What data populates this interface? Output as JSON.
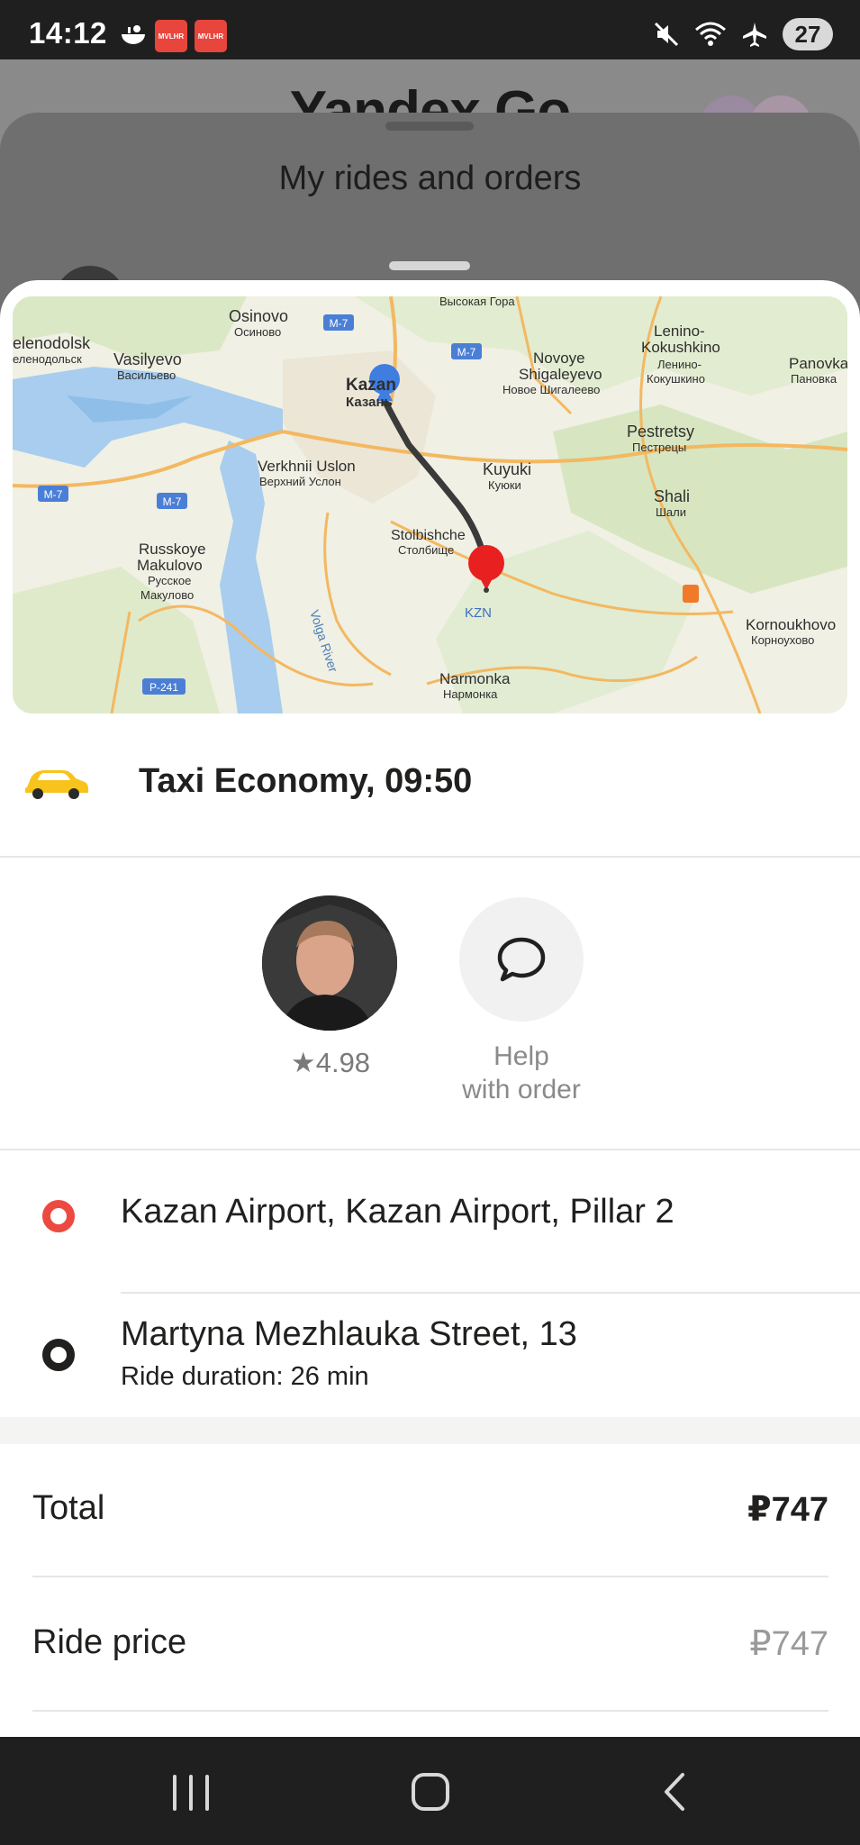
{
  "status_bar": {
    "time": "14:12",
    "battery": "27",
    "badge_label": "MVLHR",
    "icons": [
      "bowl-icon",
      "app-badge-icon",
      "app-badge-icon",
      "mute-icon",
      "wifi-icon",
      "airplane-icon",
      "battery-icon"
    ]
  },
  "background": {
    "app_logo": "Yandex Go",
    "sheet_title": "My rides and orders"
  },
  "map": {
    "labels": {
      "osinovo": "Osinovo",
      "osinovo_ru": "Осиново",
      "vysokaya_gora_ru": "Высокая Гора",
      "zelenodolsk": "elenodolsk",
      "zelenodolsk_ru": "еленодольск",
      "vasilyevo": "Vasilyevo",
      "vasilyevo_ru": "Васильево",
      "kazan": "Kazan",
      "kazan_ru": "Казань",
      "novoye": "Novoye",
      "shigaleyevo": "Shigaleyevo",
      "novoye_ru": "Новое Шигалеево",
      "lenino": "Lenino-",
      "kokushkino": "Kokushkino",
      "lenino_ru": "Ленино-",
      "kokushkino_ru": "Кокушкино",
      "panovka": "Panovka",
      "panovka_ru": "Пановка",
      "pestretsy": "Pestretsy",
      "pestretsy_ru": "Пестрецы",
      "verkhnii": "Verkhnii Uslon",
      "verkhnii_ru": "Верхний Услон",
      "kuyuki": "Kuyuki",
      "kuyuki_ru": "Куюки",
      "shali": "Shali",
      "shali_ru": "Шали",
      "stolbishche": "Stolbishche",
      "stolbishche_ru": "Столбище",
      "russkoye": "Russkoye",
      "makulovo": "Makulovo",
      "russkoye_ru": "Русское",
      "makulovo_ru": "Макулово",
      "kzn": "KZN",
      "kornoukhovo": "Kornoukhovo",
      "kornoukhovo_ru": "Корноухово",
      "narmonka": "Narmonka",
      "narmonka_ru": "Нармонка",
      "volga": "Volga River",
      "m7": "M-7",
      "p241": "P-241"
    }
  },
  "ride": {
    "title": "Taxi Economy, 09:50",
    "taxi_icon": "taxi-car-icon"
  },
  "driver": {
    "rating": "★4.98",
    "help_label_line1": "Help",
    "help_label_line2": "with order",
    "help_icon": "chat-bubble-icon"
  },
  "route": {
    "from": "Kazan Airport, Kazan Airport, Pillar 2",
    "to": "Martyna Mezhlauka Street, 13",
    "duration": "Ride duration: 26 min"
  },
  "prices": {
    "total_label": "Total",
    "total_value": "₽747",
    "ride_label": "Ride price",
    "ride_value": "₽747"
  },
  "colors": {
    "accent_red": "#ec4a41",
    "map_start_pin": "#3f7ee0",
    "map_end_pin": "#e82020",
    "taxi_yellow": "#f8c31c"
  },
  "nav_bar": {
    "icons": [
      "recent-apps-icon",
      "home-icon",
      "back-icon"
    ]
  }
}
